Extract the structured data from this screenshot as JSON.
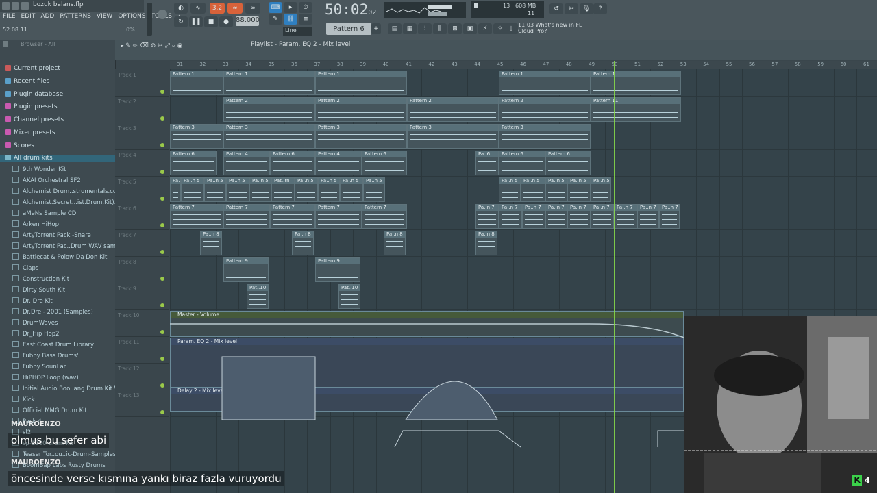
{
  "window": {
    "filename": "bozuk balans.flp"
  },
  "menu": [
    "FILE",
    "EDIT",
    "ADD",
    "PATTERNS",
    "VIEW",
    "OPTIONS",
    "TOOLS",
    "?"
  ],
  "status": {
    "time": "52:08:11",
    "cpu": "0%"
  },
  "transport": {
    "song_time": "50:02",
    "song_time_ticks": "02",
    "tempo": "88.000",
    "snap": "Line",
    "pattern": "Pattern 6"
  },
  "memory": {
    "value": "608 MB",
    "polyphony": "11",
    "count": "13"
  },
  "news": {
    "time": "11:03",
    "text": "What's new in FL Cloud Pro?"
  },
  "browser": {
    "header": "Browser - All",
    "sections": [
      {
        "label": "Current project",
        "color": "#c95a5a"
      },
      {
        "label": "Recent files",
        "color": "#5aa0c9"
      },
      {
        "label": "Plugin database",
        "color": "#5aa0c9"
      },
      {
        "label": "Plugin presets",
        "color": "#c95ab0"
      },
      {
        "label": "Channel presets",
        "color": "#c95ab0"
      },
      {
        "label": "Mixer presets",
        "color": "#c95ab0"
      },
      {
        "label": "Scores",
        "color": "#c95ab0"
      }
    ],
    "folder": "All drum kits",
    "kits": [
      "9th Wonder Kit",
      "AKAI Orchestral SF2",
      "Alchemist Drum..strumentals.com)",
      "Alchemist.Secret...ist.Drum.Kit).WAV",
      "aMeNs Sample CD",
      "Arken HiHop",
      "ArtyTorrent Pack -Snare",
      "ArtyTorrent Pac..Drum WAV samples",
      "Battlecat & Polow Da Don Kit",
      "Claps",
      "Construction Kit",
      "Dirty South Kit",
      "Dr. Dre Kit",
      "Dr.Dre - 2001 (Samples)",
      "DrumWaves",
      "Dr_Hip Hop2",
      "East Coast Drum Library",
      "Fubby  Bass Drums'",
      "Fubby SounLar",
      "HiPHOP Loop (wav)",
      "Initial Audio Boo..ang Drum Kit WiN",
      "Kick",
      "Official MMG Drum Kit",
      "Pack 4",
      "sl2",
      "sp-1200-drum-kit",
      "Teaser Tor..ou..ic-Drum-Samples",
      "BoomBap Labs Rusty Drums"
    ]
  },
  "playlist": {
    "title": "Playlist - Param. EQ 2 - Mix level",
    "ruler": [
      "31",
      "32",
      "33",
      "34",
      "35",
      "36",
      "37",
      "38",
      "39",
      "40",
      "41",
      "42",
      "43",
      "44",
      "45",
      "46",
      "47",
      "48",
      "49",
      "50",
      "51",
      "52",
      "53",
      "54",
      "55",
      "56",
      "57",
      "58",
      "59",
      "60",
      "61"
    ],
    "tracks": [
      "Track 1",
      "Track 2",
      "Track 3",
      "Track 4",
      "Track 5",
      "Track 6",
      "Track 7",
      "Track 8",
      "Track 9",
      "Track 10",
      "Track 11",
      "Track 12",
      "Track 13"
    ],
    "clips": {
      "t1": [
        "Pattern 1",
        "Pattern 1",
        "Pattern 1",
        "Pattern 1",
        "Pattern 1"
      ],
      "t2": [
        "Pattern 2",
        "Pattern 2",
        "Pattern 2",
        "Pattern 2",
        "Pattern 11"
      ],
      "t3": [
        "Pattern 3",
        "Pattern 3",
        "Pattern 3",
        "Pattern 3",
        "Pattern 3"
      ],
      "t4": [
        "Pattern 6",
        "Pattern 4",
        "Pattern 6",
        "Pattern 4",
        "Pattern 6",
        "Pa..6",
        "Pattern 6",
        "Pattern 6"
      ],
      "t5": [
        "Pa..n 5",
        "Pa..n 5",
        "Pa..n 5",
        "Pa..n 5",
        "Pa..n 5",
        "Pat..rn",
        "Pa..n 5",
        "Pa..n 5",
        "Pa..n 5",
        "Pa..n 5",
        "Pa..n 5",
        "Pa..n 5",
        "Pa..n 5",
        "Pa..n 5",
        "Pa..n 5"
      ],
      "t6": [
        "Pattern 7",
        "Pattern 7",
        "Pattern 7",
        "Pattern 7",
        "Pattern 7",
        "Pa..n 7",
        "Pa..n 7",
        "Pa..n 7",
        "Pa..n 7",
        "Pa..n 7",
        "Pa..n 7",
        "Pa..n 7",
        "Pa..n 7",
        "Pa..n 7",
        "Pa..n 7",
        "Pa..n 7"
      ],
      "t7": [
        "Pa..n 8",
        "Pa..n 8",
        "Pa..n 8",
        "Pa..n 8"
      ],
      "t8": [
        "Pattern 9",
        "Pattern 9"
      ],
      "t9": [
        "Pat..10",
        "Pat..10"
      ]
    },
    "automation": [
      {
        "label": "Master - Volume"
      },
      {
        "label": "Param. EQ 2 - Mix level"
      },
      {
        "label": "Delay 2 - Mix level"
      }
    ]
  },
  "subtitles": [
    {
      "name": "MAUROENZO",
      "text": "olmus bu sefer abi"
    },
    {
      "name": "MAUROENZO",
      "text": "öncesinde verse kısmına yankı biraz fazla vuruyordu"
    }
  ],
  "badge": {
    "text": "4"
  }
}
